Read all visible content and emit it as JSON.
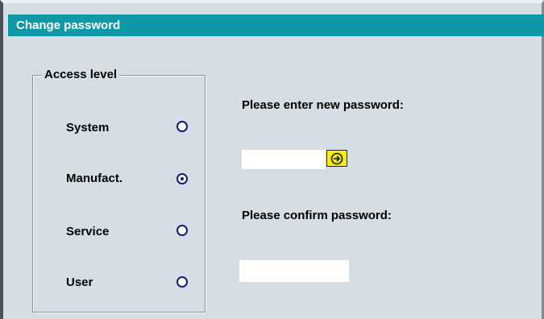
{
  "dialog": {
    "title": "Change password"
  },
  "access_level": {
    "legend": "Access level",
    "options": [
      {
        "label": "System",
        "selected": false
      },
      {
        "label": "Manufact.",
        "selected": true
      },
      {
        "label": "Service",
        "selected": false
      },
      {
        "label": "User",
        "selected": false
      }
    ]
  },
  "new_password": {
    "prompt": "Please enter new password:",
    "value": ""
  },
  "confirm_password": {
    "prompt": "Please confirm password:",
    "value": ""
  },
  "colors": {
    "titlebar": "#0f99a6",
    "background": "#d6dee3",
    "radio": "#0d1a86",
    "enter_button": "#f6f000"
  },
  "icons": {
    "enter_button": "arrow-right-circle-icon"
  }
}
